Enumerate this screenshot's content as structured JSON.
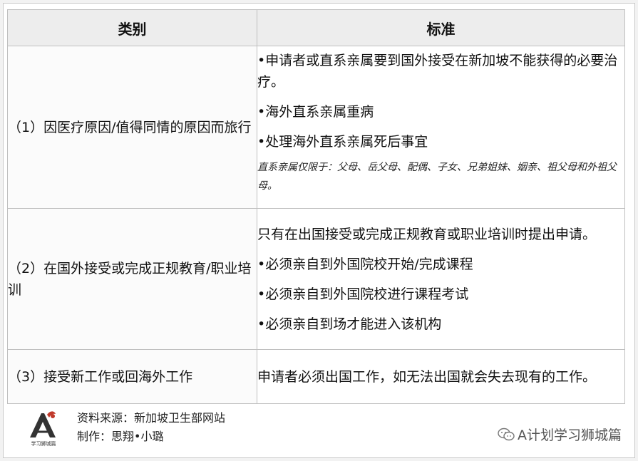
{
  "header": {
    "category": "类别",
    "standard": "标准"
  },
  "rows": [
    {
      "category": "（1）因医疗原因/值得同情的原因而旅行",
      "standards": [
        "•申请者或直系亲属要到国外接受在新加坡不能获得的必要治疗。",
        "•海外直系亲属重病",
        "•处理海外直系亲属死后事宜"
      ],
      "note": "直系亲属仅限于：父母、岳父母、配偶、子女、兄弟姐妹、姻亲、祖父母和外祖父母。"
    },
    {
      "category": "（2）在国外接受或完成正规教育/职业培训",
      "standards": [
        "只有在出国接受或完成正规教育或职业培训时提出申请。",
        "•必须亲自到外国院校开始/完成课程",
        "•必须亲自到外国院校进行课程考试",
        "•必须亲自到场才能进入该机构"
      ]
    },
    {
      "category": "（3）接受新工作或回海外工作",
      "standards": [
        "申请者必须出国工作，如无法出国就会失去现有的工作。"
      ]
    }
  ],
  "footer": {
    "source": "资料来源：新加坡卫生部网站",
    "author": "制作：思翔•小璐",
    "logo_text": "学习狮城篇",
    "logo_icon": "lion-city-logo",
    "watermark_icon": "wechat-icon",
    "watermark": "A计划学习狮城篇"
  },
  "colors": {
    "header_bg": "#ededed",
    "border": "#bfbfbf",
    "logo_red": "#c0392b"
  }
}
